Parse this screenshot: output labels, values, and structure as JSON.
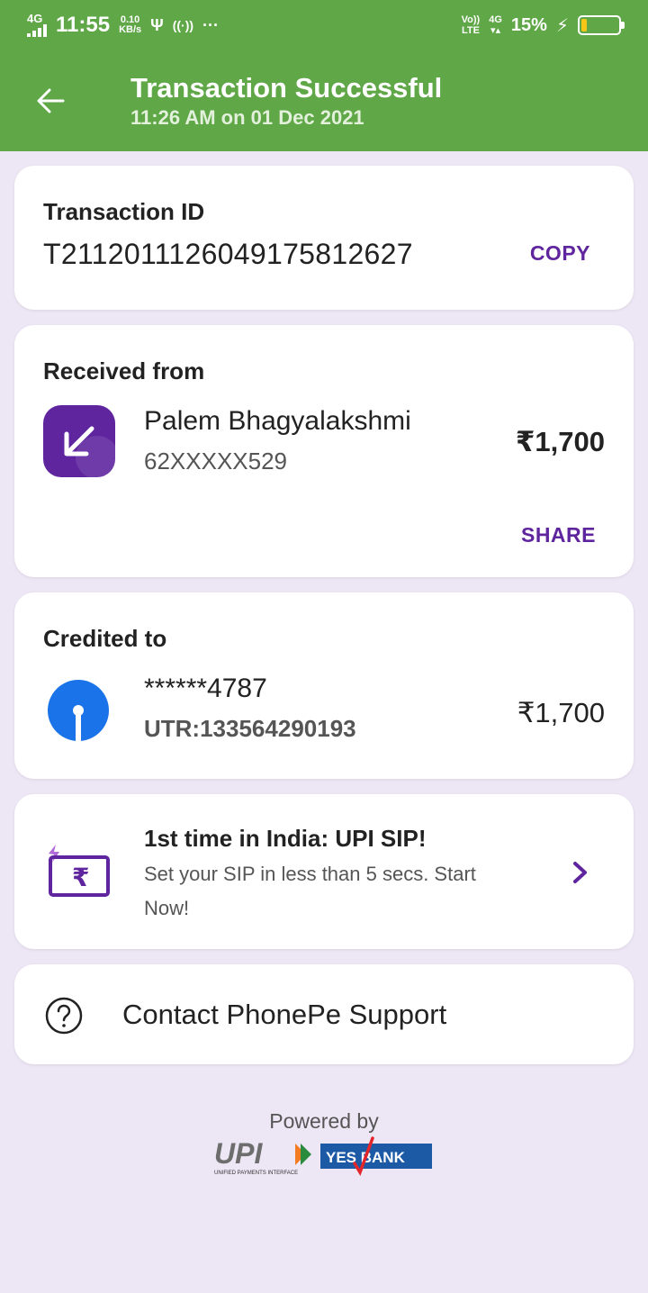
{
  "status_bar": {
    "network": "4G",
    "time": "11:55",
    "speed_value": "0.10",
    "speed_unit": "KB/s",
    "volte": "Vo))",
    "lte": "LTE",
    "network2": "4G",
    "battery_pct": "15%",
    "battery_level": 0.15
  },
  "header": {
    "title": "Transaction Successful",
    "subtitle": "11:26 AM on 01 Dec 2021"
  },
  "transaction": {
    "label": "Transaction ID",
    "id": "T2112011126049175812627",
    "copy_label": "COPY"
  },
  "received": {
    "label": "Received from",
    "name": "Palem Bhagyalakshmi",
    "phone": "62XXXXX529",
    "amount": "₹1,700",
    "share_label": "SHARE"
  },
  "credited": {
    "label": "Credited to",
    "account": "******4787",
    "utr": "UTR:133564290193",
    "amount": "₹1,700"
  },
  "promo": {
    "title": "1st time in India: UPI SIP!",
    "text": "Set your SIP in less than 5 secs. Start Now!"
  },
  "support": {
    "label": "Contact PhonePe Support"
  },
  "footer": {
    "powered_by": "Powered by",
    "upi_text": "UPI",
    "upi_tagline": "UNIFIED PAYMENTS INTERFACE",
    "bank_text": "YES BANK"
  },
  "colors": {
    "header_green": "#5fa747",
    "brand_purple": "#5f259f",
    "background": "#ede6f5",
    "sbi_blue": "#1a73e8"
  }
}
